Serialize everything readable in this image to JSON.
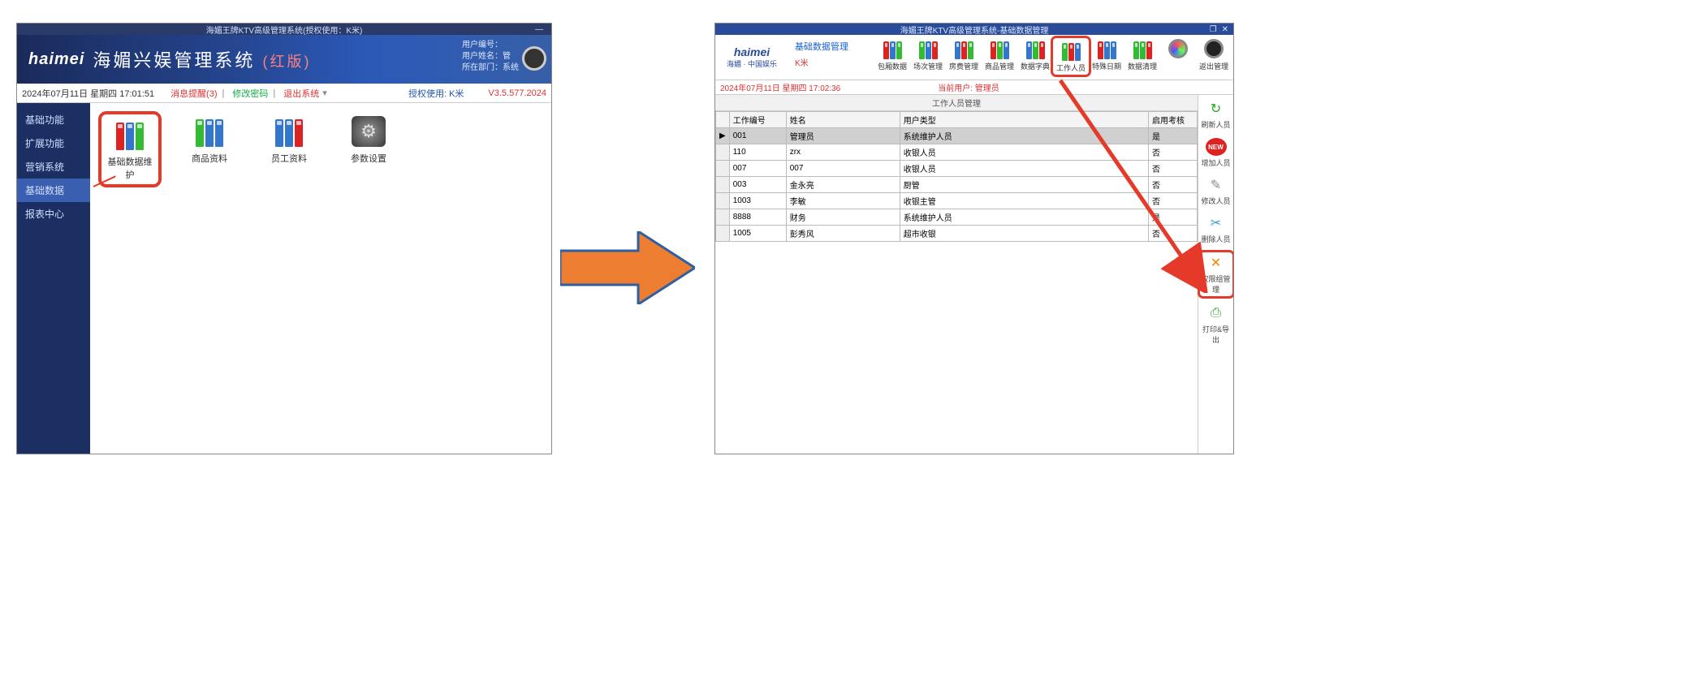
{
  "left": {
    "titlebar": "海媚王牌KTV高级管理系统(授权使用：K米)",
    "logo": "haimei",
    "sysname": "海媚兴娱管理系统",
    "sysname_suffix": "(红版)",
    "userinfo": {
      "l1": "用户编号：",
      "l2": "用户姓名：管",
      "l3": "所在部门：系统"
    },
    "status": {
      "datetime": "2024年07月11日 星期四 17:01:51",
      "msg": "消息提醒(3)",
      "pwd": "修改密码",
      "exit": "退出系统",
      "auth": "授权使用: K米",
      "ver": "V3.5.577.2024"
    },
    "side": [
      "基础功能",
      "扩展功能",
      "营销系统",
      "基础数据",
      "报表中心"
    ],
    "side_active_index": 3,
    "tools": [
      {
        "label": "基础数据维护",
        "icon": "rbg",
        "hl": true
      },
      {
        "label": "商品资料",
        "icon": "gbb"
      },
      {
        "label": "员工资料",
        "icon": "bbr"
      },
      {
        "label": "参数设置",
        "icon": "gear"
      }
    ]
  },
  "right": {
    "titlebar": "海媚王牌KTV高级管理系统-基础数据管理",
    "logo_top": "haimei",
    "logo_bottom": "海媚 · 中国娱乐",
    "crumb_top": "基础数据管理",
    "crumb_sub": "K米",
    "status_datetime": "2024年07月11日 星期四 17:02:36",
    "status_user_label": "当前用户:",
    "status_user": "管理员",
    "toolbar": [
      {
        "label": "包厢数据"
      },
      {
        "label": "场次管理"
      },
      {
        "label": "房费管理"
      },
      {
        "label": "商品管理"
      },
      {
        "label": "数据字典"
      },
      {
        "label": "工作人员",
        "hl": true
      },
      {
        "label": "特殊日期"
      },
      {
        "label": "数据清理"
      },
      {
        "label": "",
        "round": "clock"
      },
      {
        "label": "返出管理",
        "round": "dark"
      }
    ],
    "panel_title": "工作人员管理",
    "columns": [
      "工作编号",
      "姓名",
      "用户类型",
      "启用考核"
    ],
    "rows": [
      {
        "sel": true,
        "c": [
          "001",
          "管理员",
          "系统维护人员",
          "是"
        ]
      },
      {
        "c": [
          "110",
          "zrx",
          "收银人员",
          "否"
        ]
      },
      {
        "c": [
          "007",
          "007",
          "收银人员",
          "否"
        ]
      },
      {
        "c": [
          "003",
          "金永亮",
          "厨管",
          "否"
        ]
      },
      {
        "c": [
          "1003",
          "李敏",
          "收银主管",
          "否"
        ]
      },
      {
        "c": [
          "8888",
          "财务",
          "系统维护人员",
          "是"
        ]
      },
      {
        "c": [
          "1005",
          "彭秀风",
          "超市收银",
          "否"
        ]
      }
    ],
    "right_tools": [
      {
        "label": "刷新人员",
        "icon": "↻",
        "color": "#2a2"
      },
      {
        "label": "增加人员",
        "icon": "NEW",
        "color": "#d22",
        "badge": true
      },
      {
        "label": "修改人员",
        "icon": "✎",
        "color": "#888"
      },
      {
        "label": "删除人员",
        "icon": "✂",
        "color": "#39c"
      },
      {
        "label": "权限组管理",
        "icon": "✕",
        "color": "#e80",
        "hl": true
      },
      {
        "label": "打印&导出",
        "icon": "⎙",
        "color": "#3a3"
      }
    ]
  }
}
